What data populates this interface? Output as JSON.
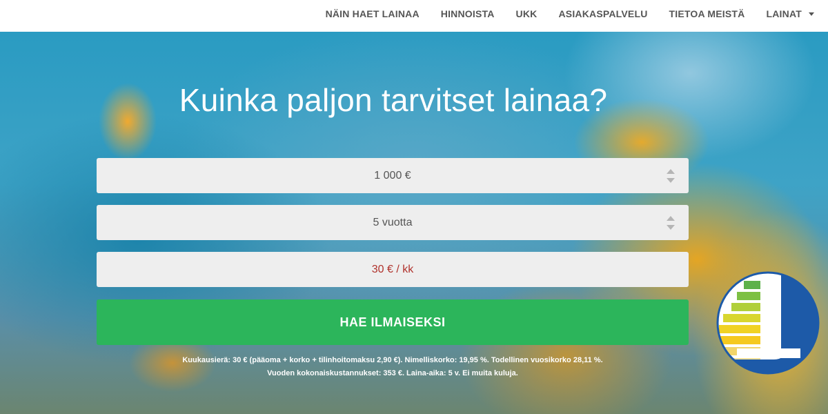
{
  "nav": {
    "items": [
      "NÄIN HAET LAINAA",
      "HINNOISTA",
      "UKK",
      "ASIAKASPALVELU",
      "TIETOA MEISTÄ",
      "LAINAT"
    ]
  },
  "hero": {
    "title": "Kuinka paljon tarvitset lainaa?",
    "amount_value": "1 000 €",
    "period_value": "5 vuotta",
    "monthly_value": "30 € / kk",
    "cta_label": "HAE ILMAISEKSI",
    "disclaimer_line1": "Kuukausierä: 30 € (pääoma + korko + tilinhoitomaksu 2,90 €). Nimelliskorko: 19,95 %. Todellinen vuosikorko 28,11 %.",
    "disclaimer_line2": "Vuoden kokonaiskustannukset: 353 €. Laina-aika: 5 v. Ei muita kuluja."
  },
  "colors": {
    "cta": "#2cb55b",
    "monthly_text": "#b0322c",
    "logo_blue": "#1d5aa8"
  },
  "icons": [
    "select-arrows-icon",
    "chevron-down-icon",
    "brand-logo"
  ]
}
